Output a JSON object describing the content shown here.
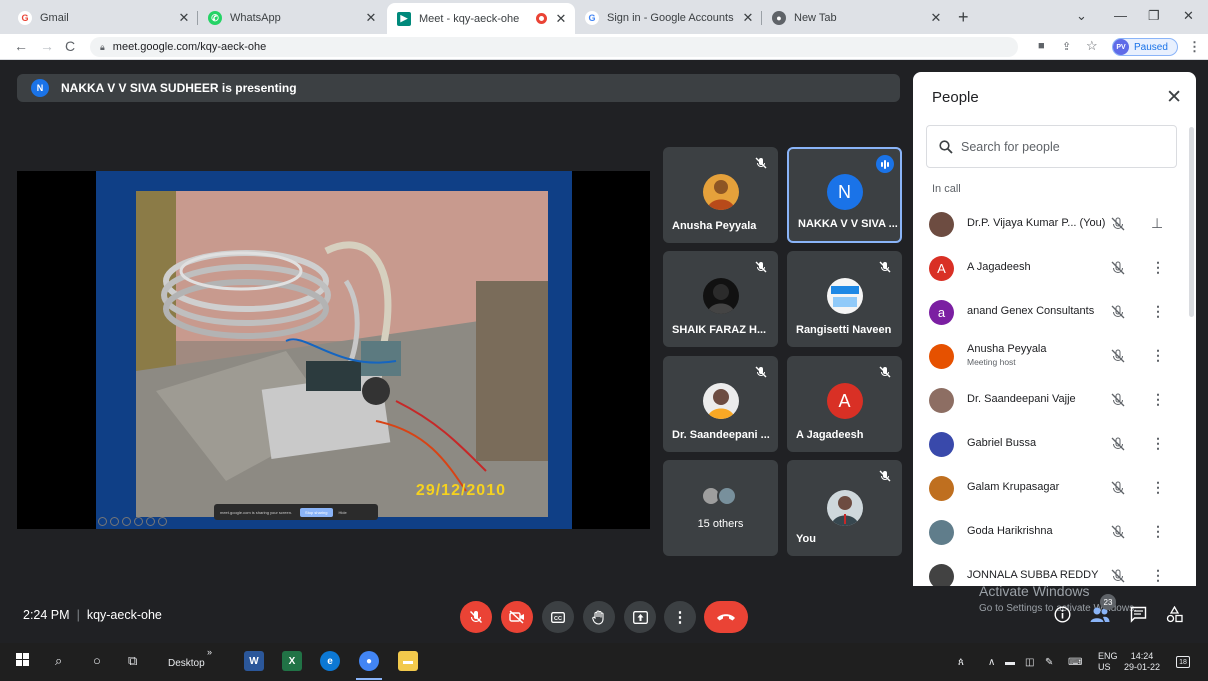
{
  "browser": {
    "tabs": [
      {
        "label": "Gmail",
        "favicon": "G",
        "color": "#ea4335"
      },
      {
        "label": "WhatsApp",
        "favicon": "W",
        "color": "#25d366"
      },
      {
        "label": "Meet - kqy-aeck-ohe",
        "favicon": "M",
        "color": "#00897b"
      },
      {
        "label": "Sign in - Google Accounts",
        "favicon": "G",
        "color": "#4285f4"
      },
      {
        "label": "New Tab",
        "favicon": "C",
        "color": "#5f6368"
      }
    ],
    "url": "meet.google.com/kqy-aeck-ohe",
    "profile_initials": "PV",
    "profile_status": "Paused"
  },
  "meet": {
    "presenting_banner": "NAKKA V V SIVA SUDHEER is presenting",
    "presenter_initial": "N",
    "slide": {
      "photo_date_stamp": "29/12/2010",
      "share_notice": "meet.google.com is sharing your screen.",
      "stop_sharing": "Stop sharing",
      "hide": "Hide"
    },
    "tiles": [
      {
        "name": "Anusha Peyyala",
        "muted": true
      },
      {
        "name": "NAKKA V V SIVA ...",
        "initial": "N",
        "speaking": true
      },
      {
        "name": "SHAIK FARAZ H...",
        "muted": true
      },
      {
        "name": "Rangisetti Naveen",
        "muted": true
      },
      {
        "name": "Dr. Saandeepani ...",
        "muted": true
      },
      {
        "name": "A Jagadeesh",
        "initial": "A",
        "muted": true
      },
      {
        "name": "15 others"
      },
      {
        "name": "You",
        "muted": true
      }
    ],
    "meeting_time": "2:24 PM",
    "meeting_code": "kqy-aeck-ohe",
    "participant_count": "23"
  },
  "people_panel": {
    "title": "People",
    "search_placeholder": "Search for people",
    "section_label": "In call",
    "participants": [
      {
        "name": "Dr.P. Vijaya Kumar P...  (You)",
        "avatar_color": "#6d4c41",
        "pin": true
      },
      {
        "name": "A Jagadeesh",
        "initial": "A",
        "avatar_color": "#d93025"
      },
      {
        "name": "anand Genex Consultants",
        "initial": "a",
        "avatar_color": "#7b1fa2"
      },
      {
        "name": "Anusha Peyyala",
        "sub": "Meeting host",
        "avatar_color": "#e65100"
      },
      {
        "name": "Dr. Saandeepani Vajje",
        "avatar_color": "#8d6e63"
      },
      {
        "name": "Gabriel Bussa",
        "avatar_color": "#3949ab"
      },
      {
        "name": "Galam Krupasagar",
        "avatar_color": "#bf6f1f"
      },
      {
        "name": "Goda Harikrishna",
        "avatar_color": "#607d8b"
      },
      {
        "name": "JONNALA SUBBA REDDY",
        "avatar_color": "#424242"
      }
    ]
  },
  "watermark": {
    "line1": "Activate Windows",
    "line2": "Go to Settings to activate Windows."
  },
  "taskbar": {
    "desktop_label": "Desktop",
    "lang_line1": "ENG",
    "lang_line2": "US",
    "time": "14:24",
    "date": "29-01-22",
    "notifications": "18"
  }
}
